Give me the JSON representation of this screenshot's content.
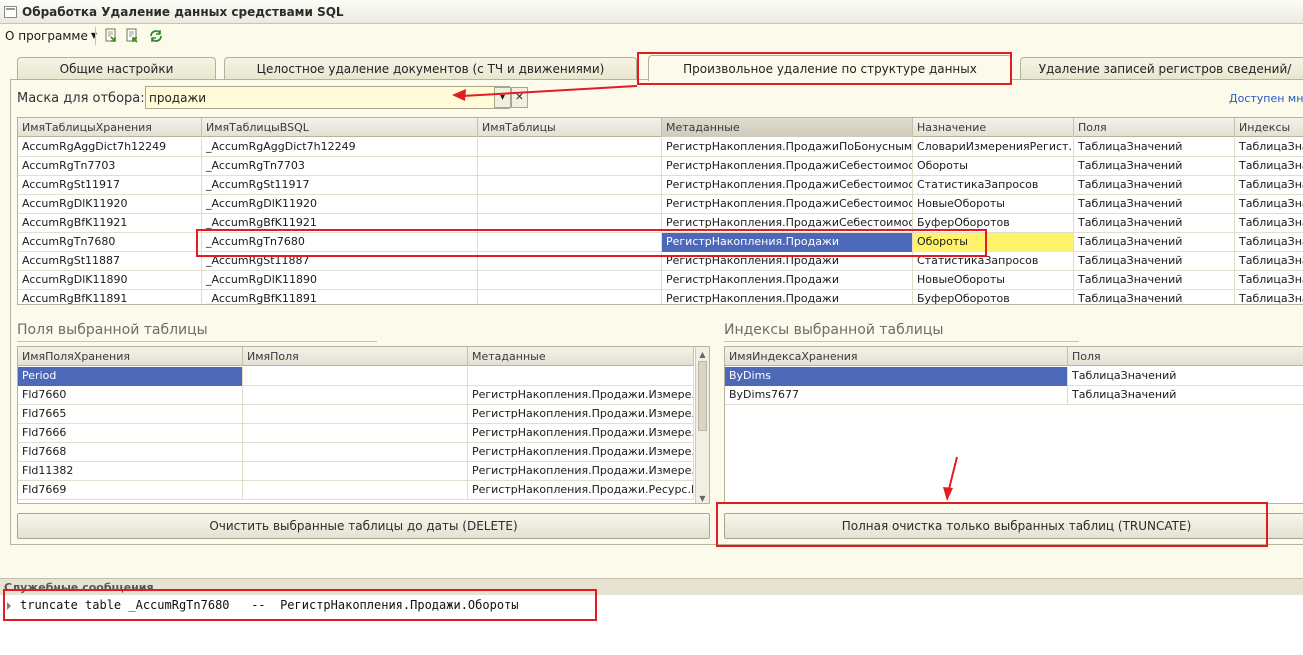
{
  "window": {
    "title": "Обработка  Удаление данных средствами SQL"
  },
  "toolbar": {
    "about_label": "О программе"
  },
  "tabs": [
    {
      "label": "Общие настройки"
    },
    {
      "label": "Целостное удаление документов (с ТЧ и движениями)"
    },
    {
      "label": "Произвольное удаление по структуре данных"
    },
    {
      "label": "Удаление записей регистров сведений/"
    }
  ],
  "active_tab": 2,
  "filter": {
    "label": "Маска для отбора:",
    "value": "продажи",
    "link": "Доступен мно"
  },
  "main_table": {
    "columns": [
      "ИмяТаблицыХранения",
      "ИмяТаблицыBSQL",
      "ИмяТаблицы",
      "Метаданные",
      "Назначение",
      "Поля",
      "Индексы"
    ],
    "rows": [
      [
        "AccumRgAggDict7h12249",
        "_AccumRgAggDict7h12249",
        "",
        "РегистрНакопления.ПродажиПоБонусным...",
        "СловариИзмеренияРегист...",
        "ТаблицаЗначений",
        "ТаблицаЗна"
      ],
      [
        "AccumRgTn7703",
        "_AccumRgTn7703",
        "",
        "РегистрНакопления.ПродажиСебестоимость",
        "Обороты",
        "ТаблицаЗначений",
        "ТаблицаЗна"
      ],
      [
        "AccumRgSt11917",
        "_AccumRgSt11917",
        "",
        "РегистрНакопления.ПродажиСебестоимость",
        "СтатистикаЗапросов",
        "ТаблицаЗначений",
        "ТаблицаЗна"
      ],
      [
        "AccumRgDlK11920",
        "_AccumRgDlK11920",
        "",
        "РегистрНакопления.ПродажиСебестоимость",
        "НовыеОбороты",
        "ТаблицаЗначений",
        "ТаблицаЗна"
      ],
      [
        "AccumRgBfK11921",
        "_AccumRgBfK11921",
        "",
        "РегистрНакопления.ПродажиСебестоимость",
        "БуферОборотов",
        "ТаблицаЗначений",
        "ТаблицаЗна"
      ],
      [
        "AccumRgTn7680",
        "_AccumRgTn7680",
        "",
        "РегистрНакопления.Продажи",
        "Обороты",
        "ТаблицаЗначений",
        "ТаблицаЗна"
      ],
      [
        "AccumRgSt11887",
        "_AccumRgSt11887",
        "",
        "РегистрНакопления.Продажи",
        "СтатистикаЗапросов",
        "ТаблицаЗначений",
        "ТаблицаЗна"
      ],
      [
        "AccumRgDlK11890",
        "_AccumRgDlK11890",
        "",
        "РегистрНакопления.Продажи",
        "НовыеОбороты",
        "ТаблицаЗначений",
        "ТаблицаЗна"
      ],
      [
        "AccumRgBfK11891",
        "_AccumRgBfK11891",
        "",
        "РегистрНакопления.Продажи",
        "БуферОборотов",
        "ТаблицаЗначений",
        "ТаблицаЗна"
      ]
    ],
    "selected_row": 5
  },
  "fields_section": {
    "title": "Поля выбранной таблицы",
    "columns": [
      "ИмяПоляХранения",
      "ИмяПоля",
      "Метаданные"
    ],
    "rows": [
      [
        "Period",
        "",
        ""
      ],
      [
        "Fld7660",
        "",
        "РегистрНакопления.Продажи.Измере..."
      ],
      [
        "Fld7665",
        "",
        "РегистрНакопления.Продажи.Измере..."
      ],
      [
        "Fld7666",
        "",
        "РегистрНакопления.Продажи.Измере..."
      ],
      [
        "Fld7668",
        "",
        "РегистрНакопления.Продажи.Измере..."
      ],
      [
        "Fld11382",
        "",
        "РегистрНакопления.Продажи.Измере..."
      ],
      [
        "Fld7669",
        "",
        "РегистрНакопления.Продажи.Ресурс.К..."
      ]
    ],
    "selected_row": 0
  },
  "indexes_section": {
    "title": "Индексы выбранной таблицы",
    "columns": [
      "ИмяИндексаХранения",
      "Поля"
    ],
    "rows": [
      [
        "ByDims",
        "ТаблицаЗначений"
      ],
      [
        "ByDims7677",
        "ТаблицаЗначений"
      ]
    ],
    "selected_row": 0
  },
  "buttons": {
    "delete_label": "Очистить выбранные таблицы до даты (DELETE)",
    "truncate_label": "Полная очистка только выбранных таблиц (TRUNCATE)"
  },
  "messages": {
    "title": "Служебные сообщения",
    "line": "truncate table _AccumRgTn7680   --  РегистрНакопления.Продажи.Обороты"
  },
  "colors": {
    "selection": "#4e68b8",
    "highlight": "#fff36b",
    "annotation": "#e31b23",
    "background": "#fbfaeb"
  },
  "icons": [
    "window-icon",
    "export-icon",
    "import-icon",
    "refresh-icon",
    "dropdown-arrow-icon",
    "clear-icon",
    "scroll-up-icon",
    "scroll-down-icon"
  ]
}
